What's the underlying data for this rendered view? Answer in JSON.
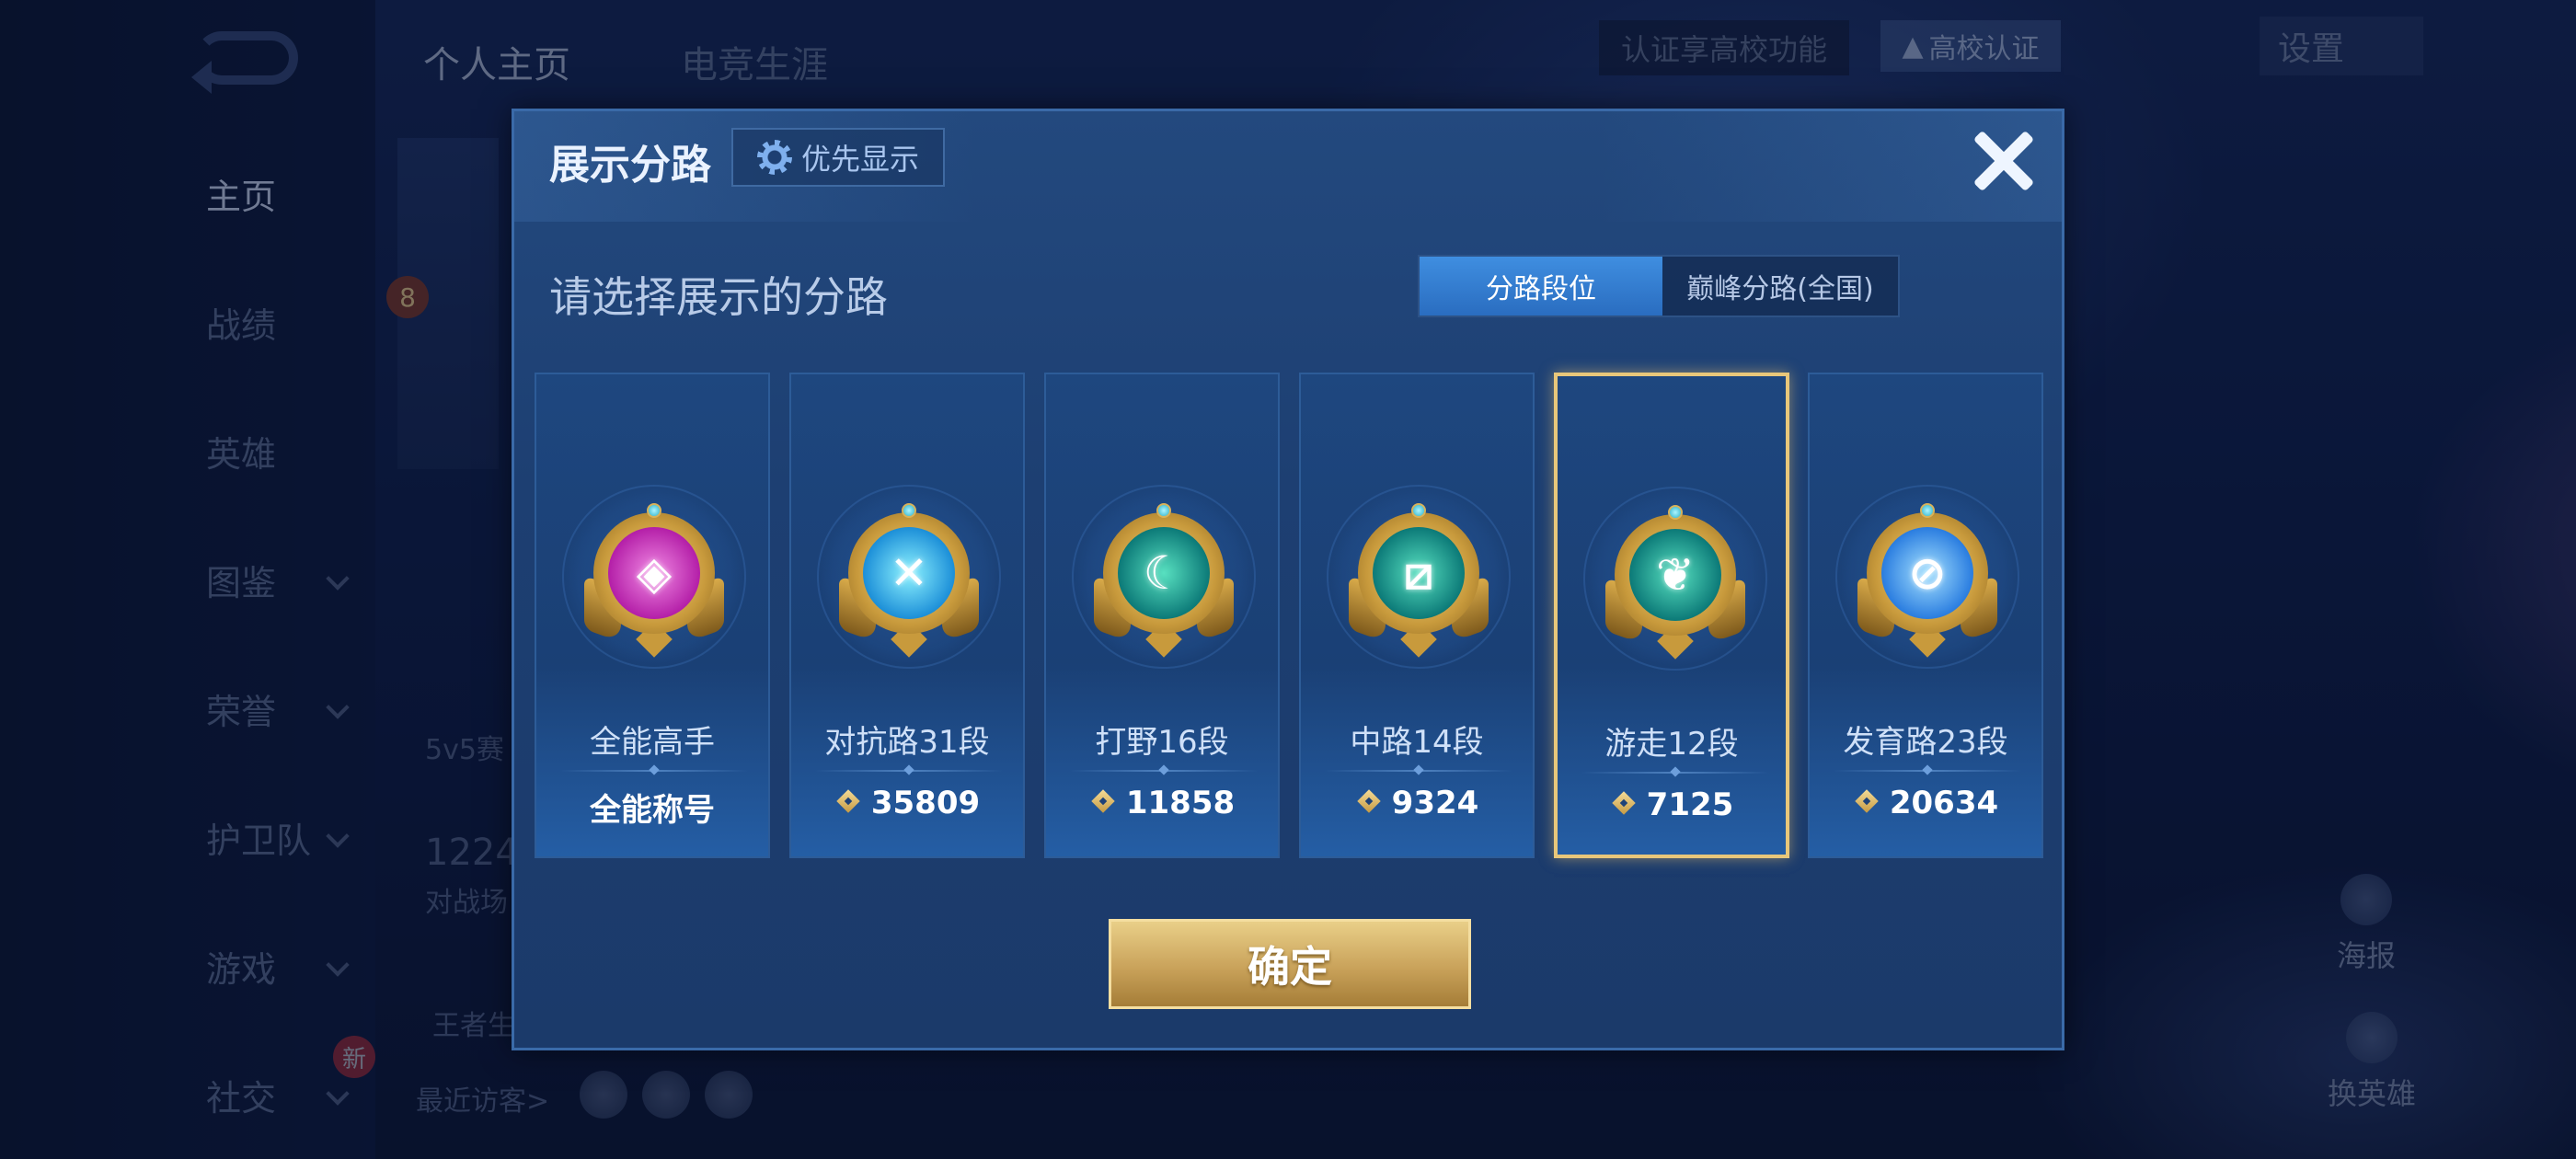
{
  "background": {
    "nav": [
      {
        "label": "主页",
        "active": true,
        "chevron": false
      },
      {
        "label": "战绩",
        "active": false,
        "chevron": false
      },
      {
        "label": "英雄",
        "active": false,
        "chevron": false
      },
      {
        "label": "图鉴",
        "active": false,
        "chevron": true
      },
      {
        "label": "荣誉",
        "active": false,
        "chevron": true
      },
      {
        "label": "护卫队",
        "active": false,
        "chevron": true
      },
      {
        "label": "游戏",
        "active": false,
        "chevron": true
      },
      {
        "label": "社交",
        "active": false,
        "chevron": true
      }
    ],
    "new_badge": "新",
    "tabs": [
      "个人主页",
      "电竞生涯"
    ],
    "cert_prompt": "认证享高校功能",
    "cert_button": "高校认证",
    "settings": "设置",
    "level_badge": "8",
    "mode_text": "5v5赛",
    "count_text": "1224",
    "count_sub": "对战场",
    "king_text": "王者生",
    "visitors_label": "最近访客>",
    "right_poster": "海报",
    "right_swap": "换英雄"
  },
  "modal": {
    "title": "展示分路",
    "priority_label": "优先显示",
    "subtitle": "请选择展示的分路",
    "segments": [
      {
        "label": "分路段位",
        "active": true
      },
      {
        "label": "巅峰分路(全国)",
        "active": false
      }
    ],
    "cards": [
      {
        "label": "全能高手",
        "value": "全能称号",
        "show_icon": false,
        "selected": false,
        "color": "pink",
        "symbol": "◈"
      },
      {
        "label": "对抗路31段",
        "value": "35809",
        "show_icon": true,
        "selected": false,
        "color": "cyan",
        "symbol": "✕"
      },
      {
        "label": "打野16段",
        "value": "11858",
        "show_icon": true,
        "selected": false,
        "color": "teal",
        "symbol": "☾"
      },
      {
        "label": "中路14段",
        "value": "9324",
        "show_icon": true,
        "selected": false,
        "color": "teal",
        "symbol": "⧄"
      },
      {
        "label": "游走12段",
        "value": "7125",
        "show_icon": true,
        "selected": true,
        "color": "teal",
        "symbol": "❦"
      },
      {
        "label": "发育路23段",
        "value": "20634",
        "show_icon": true,
        "selected": false,
        "color": "blue",
        "symbol": "⊘"
      }
    ],
    "confirm_label": "确定"
  }
}
